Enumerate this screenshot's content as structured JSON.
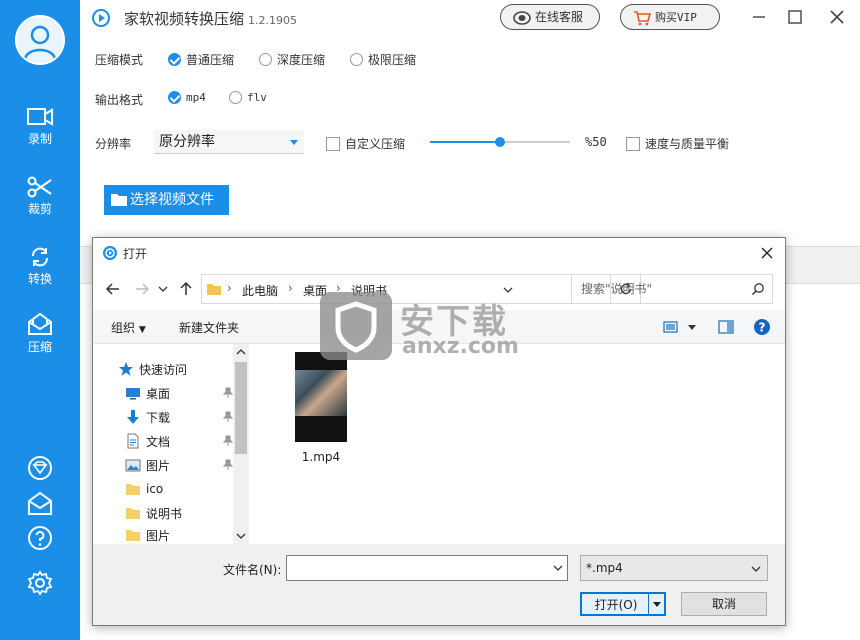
{
  "app": {
    "title": "家软视频转换压缩",
    "version": "1.2.1905",
    "online_service": "在线客服",
    "buy_vip": "购买VIP"
  },
  "sidebar": {
    "items": [
      {
        "label": "录制",
        "icon": "video-record-icon"
      },
      {
        "label": "裁剪",
        "icon": "scissors-icon"
      },
      {
        "label": "转换",
        "icon": "convert-icon"
      },
      {
        "label": "压缩",
        "icon": "compress-icon"
      }
    ],
    "bottom_icons": [
      "vip-diamond-icon",
      "mail-icon",
      "help-icon",
      "settings-icon"
    ]
  },
  "settings": {
    "compress_mode_label": "压缩模式",
    "compress_modes": [
      {
        "label": "普通压缩",
        "checked": true
      },
      {
        "label": "深度压缩",
        "checked": false
      },
      {
        "label": "极限压缩",
        "checked": false
      }
    ],
    "output_format_label": "输出格式",
    "output_formats": [
      {
        "label": "mp4",
        "checked": true
      },
      {
        "label": "flv",
        "checked": false
      }
    ],
    "resolution_label": "分辨率",
    "resolution_value": "原分辨率",
    "custom_compress_label": "自定义压缩",
    "slider_percent": 50,
    "slider_text": "%50",
    "speed_quality_label": "速度与质量平衡",
    "choose_file_button": "选择视频文件"
  },
  "dialog": {
    "title": "打开",
    "breadcrumb": [
      "此电脑",
      "桌面",
      "说明书"
    ],
    "search_placeholder": "搜索\"说明书\"",
    "organize": "组织",
    "new_folder": "新建文件夹",
    "tree": [
      {
        "label": "快速访问",
        "icon": "star-icon",
        "pinned": false
      },
      {
        "label": "桌面",
        "icon": "desktop-icon",
        "pinned": true
      },
      {
        "label": "下载",
        "icon": "download-icon",
        "pinned": true
      },
      {
        "label": "文档",
        "icon": "document-icon",
        "pinned": true
      },
      {
        "label": "图片",
        "icon": "picture-icon",
        "pinned": true
      },
      {
        "label": "ico",
        "icon": "folder-icon",
        "pinned": false
      },
      {
        "label": "说明书",
        "icon": "folder-icon",
        "pinned": false
      },
      {
        "label": "图片",
        "icon": "folder-icon",
        "pinned": false
      }
    ],
    "files": [
      {
        "name": "1.mp4"
      }
    ],
    "filename_label": "文件名(N):",
    "filename_value": "",
    "filetype": "*.mp4",
    "open_button": "打开(O)",
    "cancel_button": "取消"
  },
  "watermark": {
    "text": "安下载",
    "sub": "anxz.com"
  },
  "colors": {
    "brand": "#1b8fe8",
    "dialog_accent": "#0078d7"
  }
}
